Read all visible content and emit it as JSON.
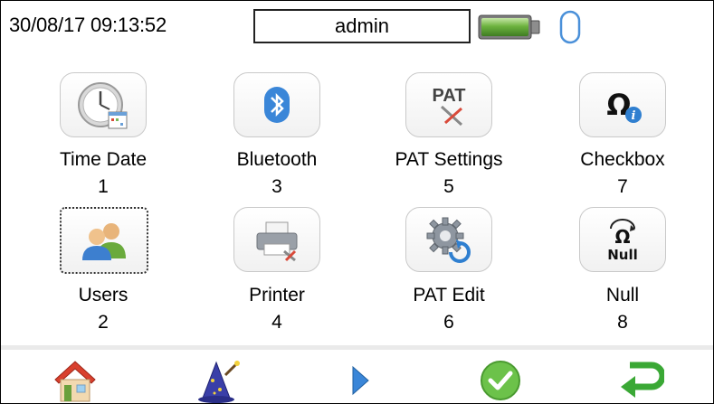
{
  "status": {
    "datetime": "30/08/17 09:13:52",
    "user": "admin"
  },
  "tiles": [
    {
      "label": "Time Date",
      "number": "1",
      "icon": "clock-calendar-icon"
    },
    {
      "label": "Bluetooth",
      "number": "3",
      "icon": "bluetooth-icon"
    },
    {
      "label": "PAT Settings",
      "number": "5",
      "icon": "pat-settings-icon"
    },
    {
      "label": "Checkbox",
      "number": "7",
      "icon": "ohm-info-icon"
    },
    {
      "label": "Users",
      "number": "2",
      "icon": "users-icon"
    },
    {
      "label": "Printer",
      "number": "4",
      "icon": "printer-icon"
    },
    {
      "label": "PAT Edit",
      "number": "6",
      "icon": "gear-refresh-icon"
    },
    {
      "label": "Null",
      "number": "8",
      "icon": "null-icon"
    }
  ],
  "icon_texts": {
    "pat": "PAT",
    "null": "Null",
    "omega": "Ω"
  },
  "bottom_nav": [
    "home-icon",
    "wizard-icon",
    "play-icon",
    "check-icon",
    "return-icon"
  ],
  "colors": {
    "battery": "#6db33f",
    "usb": "#4a90d9",
    "check": "#6cc24a",
    "return": "#3aa835"
  }
}
